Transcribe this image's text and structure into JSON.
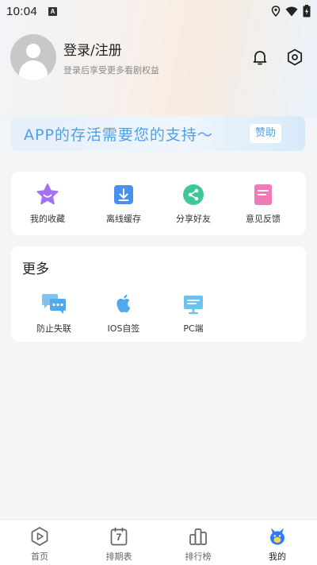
{
  "status_bar": {
    "time": "10:04",
    "badge": "A"
  },
  "profile": {
    "title": "登录/注册",
    "subtitle": "登录后享受更多看剧权益"
  },
  "banner": {
    "text": "APP的存活需要您的支持～",
    "button": "赞助"
  },
  "quick_actions": [
    {
      "label": "我的收藏",
      "icon": "star-icon"
    },
    {
      "label": "离线缓存",
      "icon": "download-icon"
    },
    {
      "label": "分享好友",
      "icon": "share-icon"
    },
    {
      "label": "意见反馈",
      "icon": "feedback-icon"
    }
  ],
  "more": {
    "title": "更多",
    "items": [
      {
        "label": "防止失联",
        "icon": "chat-bubbles-icon"
      },
      {
        "label": "IOS自签",
        "icon": "apple-icon"
      },
      {
        "label": "PC端",
        "icon": "monitor-icon"
      }
    ]
  },
  "bottom_nav": [
    {
      "label": "首页",
      "icon": "play-icon"
    },
    {
      "label": "排期表",
      "icon": "calendar-icon",
      "badge": "7"
    },
    {
      "label": "排行榜",
      "icon": "ranking-icon"
    },
    {
      "label": "我的",
      "icon": "profile-mascot-icon",
      "active": true
    }
  ],
  "colors": {
    "accent_blue": "#4f9ee9",
    "star_purple": "#a073f0",
    "download_blue": "#4a90f0",
    "share_green": "#3cc99a",
    "feedback_pink": "#f07ab8",
    "nav_active_blue": "#2f7cf6"
  }
}
